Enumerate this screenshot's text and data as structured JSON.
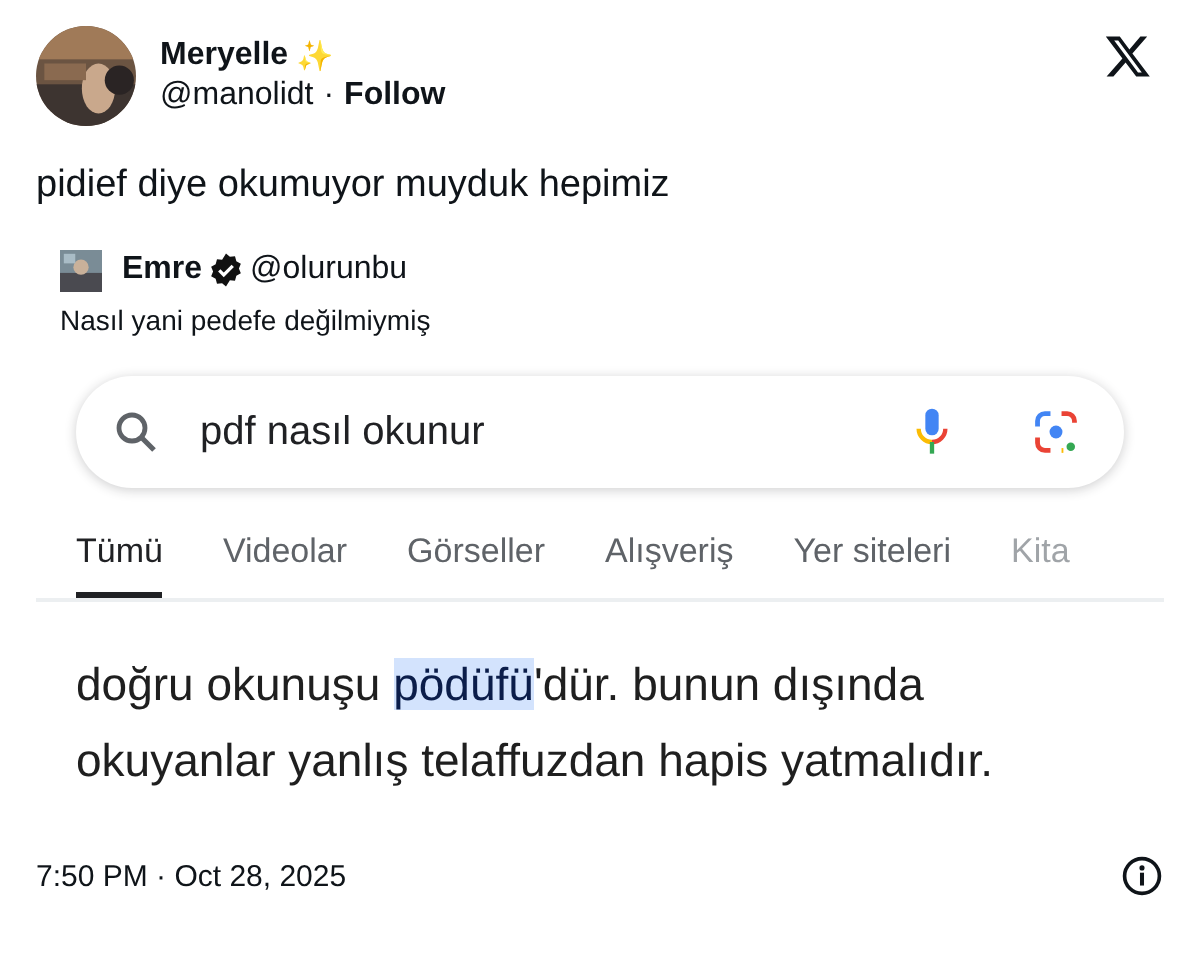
{
  "author": {
    "name": "Meryelle",
    "emoji": "✨",
    "handle": "@manolidt",
    "separator": "·",
    "follow": "Follow"
  },
  "text": "pidief diye okumuyor muyduk hepimiz",
  "quote": {
    "name": "Emre",
    "verified": true,
    "handle": "@olurunbu",
    "text": "Nasıl yani pedefe değilmiymiş"
  },
  "search": {
    "value": "pdf nasıl okunur"
  },
  "tabs": [
    {
      "label": "Tümü",
      "selected": true
    },
    {
      "label": "Videolar",
      "selected": false
    },
    {
      "label": "Görseller",
      "selected": false
    },
    {
      "label": "Alışveriş",
      "selected": false
    },
    {
      "label": "Yer siteleri",
      "selected": false
    },
    {
      "label": "Kita",
      "selected": false
    }
  ],
  "answer": [
    {
      "text": "doğru okunuşu ",
      "highlighted": false
    },
    {
      "text": "pödüfü",
      "highlighted": true
    },
    {
      "text": "'dür. bunun dışında okuyanlar yanlış telaffuzdan hapis yatmalıdır.",
      "highlighted": false
    }
  ],
  "timestamp": "7:50 PM · Oct 28, 2025"
}
